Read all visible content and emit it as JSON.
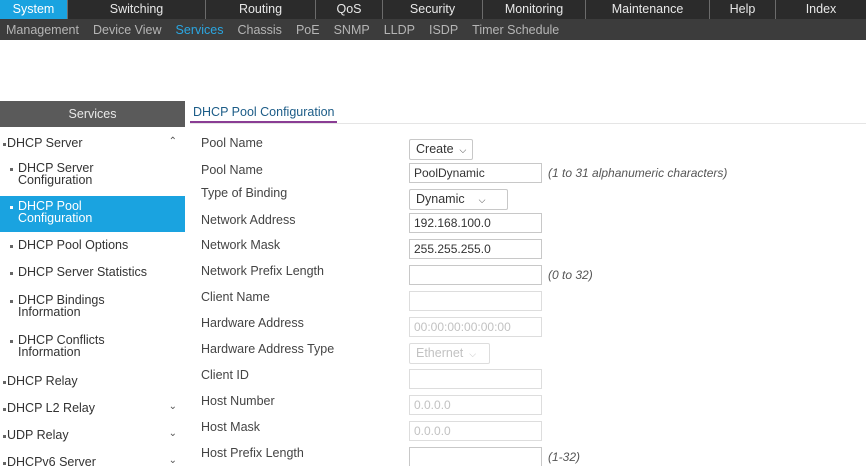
{
  "topnav": {
    "tabs": [
      "System",
      "Switching",
      "Routing",
      "QoS",
      "Security",
      "Monitoring",
      "Maintenance",
      "Help",
      "Index"
    ],
    "active": "System"
  },
  "subnav": {
    "items": [
      "Management",
      "Device View",
      "Services",
      "Chassis",
      "PoE",
      "SNMP",
      "LLDP",
      "ISDP",
      "Timer Schedule"
    ],
    "active": "Services"
  },
  "sidebar": {
    "header": "Services",
    "items": [
      {
        "label": "DHCP Server",
        "level": "top",
        "chevron": "up"
      },
      {
        "label": "DHCP Server Configuration",
        "level": "sub"
      },
      {
        "label": "DHCP Pool Configuration",
        "level": "sub",
        "active": true
      },
      {
        "label": "DHCP Pool Options",
        "level": "sub"
      },
      {
        "label": "DHCP Server Statistics",
        "level": "sub"
      },
      {
        "label": "DHCP Bindings Information",
        "level": "sub"
      },
      {
        "label": "DHCP Conflicts Information",
        "level": "sub"
      },
      {
        "label": "DHCP Relay",
        "level": "top"
      },
      {
        "label": "DHCP L2 Relay",
        "level": "top",
        "chevron": "down"
      },
      {
        "label": "UDP Relay",
        "level": "top",
        "chevron": "down"
      },
      {
        "label": "DHCPv6 Server",
        "level": "top",
        "chevron": "down"
      }
    ]
  },
  "main": {
    "section_title": "DHCP Pool Configuration",
    "fields": {
      "pool_name_select": {
        "label": "Pool Name",
        "value": "Create"
      },
      "pool_name": {
        "label": "Pool Name",
        "value": "PoolDynamic",
        "hint": "(1 to 31 alphanumeric characters)"
      },
      "type_of_binding": {
        "label": "Type of Binding",
        "value": "Dynamic"
      },
      "network_address": {
        "label": "Network Address",
        "value": "192.168.100.0"
      },
      "network_mask": {
        "label": "Network Mask",
        "value": "255.255.255.0"
      },
      "network_prefix_length": {
        "label": "Network Prefix Length",
        "value": "",
        "hint": "(0 to 32)"
      },
      "client_name": {
        "label": "Client Name",
        "value": ""
      },
      "hardware_address": {
        "label": "Hardware Address",
        "value": "00:00:00:00:00:00"
      },
      "hardware_address_type": {
        "label": "Hardware Address Type",
        "value": "Ethernet"
      },
      "client_id": {
        "label": "Client ID",
        "value": ""
      },
      "host_number": {
        "label": "Host Number",
        "value": "0.0.0.0"
      },
      "host_mask": {
        "label": "Host Mask",
        "value": "0.0.0.0"
      },
      "host_prefix_length": {
        "label": "Host Prefix Length",
        "value": "",
        "hint": "(1-32)"
      }
    }
  },
  "colors": {
    "accent": "#1aa3e0",
    "topnav_bg": "#2b2b2b",
    "subnav_bg": "#3c3c3c",
    "sidebar_header_bg": "#5a5a5a",
    "section_underline": "#8a3d94"
  }
}
